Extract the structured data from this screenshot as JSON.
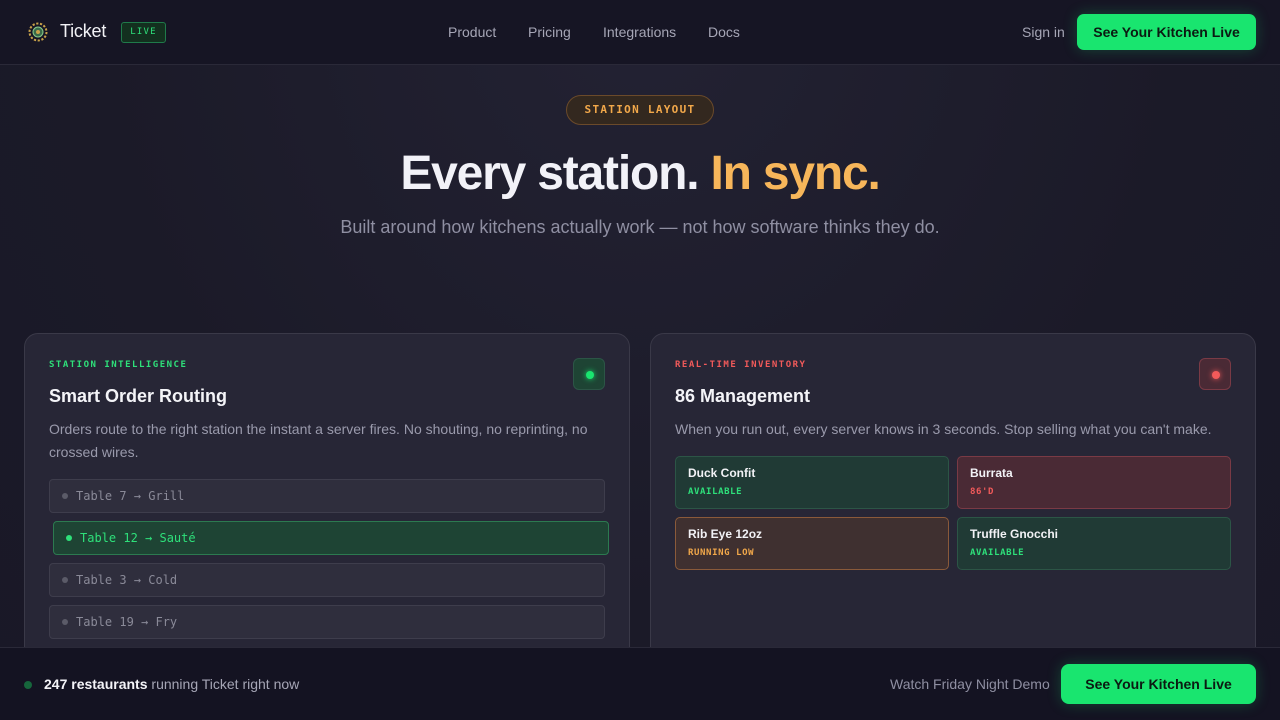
{
  "nav": {
    "brand": "Ticket",
    "logo_icon": "gear-badge-icon",
    "live_badge": "LIVE",
    "links": [
      "Product",
      "Pricing",
      "Integrations",
      "Docs"
    ],
    "signin": "Sign in",
    "cta": "See Your Kitchen Live"
  },
  "hero": {
    "eyebrow": "STATION LAYOUT",
    "title_main": "Every station.",
    "title_accent": "In sync.",
    "subtitle": "Built around how kitchens actually work — not how software thinks they do."
  },
  "cards": {
    "routing": {
      "eyebrow": "STATION INTELLIGENCE",
      "title": "Smart Order Routing",
      "desc": "Orders route to the right station the instant a server fires. No shouting, no reprinting, no crossed wires.",
      "status_icon": "status-dot-icon",
      "rows": [
        {
          "label": "Table 7 → Grill",
          "active": false
        },
        {
          "label": "Table 12 → Sauté",
          "active": true
        },
        {
          "label": "Table 3 → Cold",
          "active": false
        },
        {
          "label": "Table 19 → Fry",
          "active": false
        }
      ]
    },
    "inventory": {
      "eyebrow": "REAL-TIME INVENTORY",
      "title": "86 Management",
      "desc": "When you run out, every server knows in 3 seconds. Stop selling what you can't make.",
      "status_icon": "status-dot-icon",
      "items": [
        {
          "name": "Duck Confit",
          "state": "AVAILABLE"
        },
        {
          "name": "Burrata",
          "state": "86'D"
        },
        {
          "name": "Rib Eye 12oz",
          "state": "RUNNING LOW"
        },
        {
          "name": "Truffle Gnocchi",
          "state": "AVAILABLE"
        }
      ]
    }
  },
  "bottom": {
    "count": "247 restaurants",
    "text": "running Ticket right now",
    "watch": "Watch Friday Night Demo",
    "cta": "See Your Kitchen Live"
  },
  "colors": {
    "accent_green": "#19e56f",
    "accent_orange": "#f7b65a",
    "alert_red": "#f25a5a",
    "background": "#1c1b2a"
  }
}
